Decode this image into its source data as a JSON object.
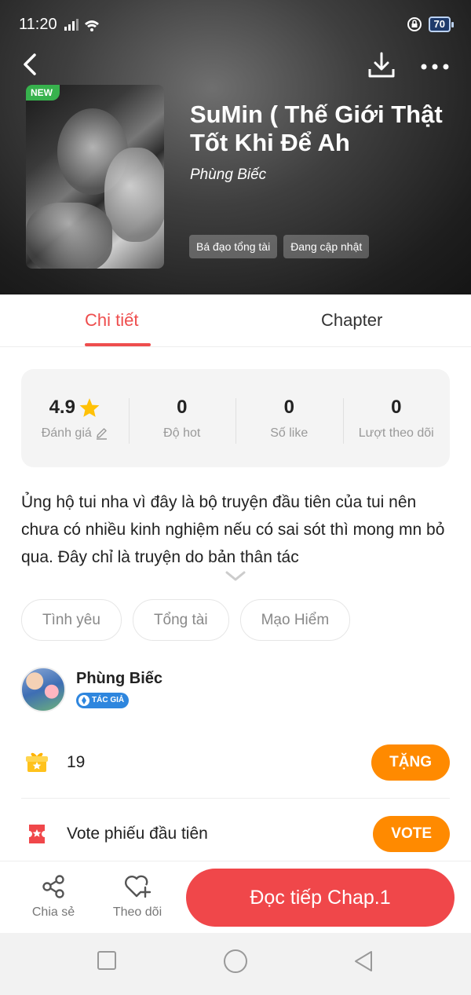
{
  "status_bar": {
    "time": "11:20",
    "battery": "70"
  },
  "book": {
    "new_badge": "NEW",
    "title": "SuMin ( Thế Giới Thật Tốt Khi Để Ah",
    "author": "Phùng Biếc",
    "tags": [
      "Bá đạo tổng tài",
      "Đang cập nhật"
    ]
  },
  "tabs": {
    "detail": "Chi tiết",
    "chapter": "Chapter"
  },
  "stats": [
    {
      "value": "4.9",
      "label": "Đánh giá"
    },
    {
      "value": "0",
      "label": "Độ hot"
    },
    {
      "value": "0",
      "label": "Số like"
    },
    {
      "value": "0",
      "label": "Lượt theo dõi"
    }
  ],
  "description": "Ủng hộ tui nha vì đây là bộ truyện đầu tiên của tui nên chưa có nhiều kinh nghiệm nếu có sai sót thì mong mn bỏ qua. Đây chỉ là truyện do bản thân tác",
  "genres": [
    "Tình yêu",
    "Tổng tài",
    "Mạo Hiểm"
  ],
  "author_section": {
    "name": "Phùng Biếc",
    "badge": "TÁC GIẢ"
  },
  "gift": {
    "count": "19",
    "button": "TẶNG"
  },
  "vote": {
    "text": "Vote phiếu đầu tiên",
    "button": "VOTE"
  },
  "bottom_bar": {
    "share": "Chia sẻ",
    "follow": "Theo dõi",
    "read": "Đọc tiếp Chap.1"
  },
  "colors": {
    "accent": "#ee4d4d",
    "orange": "#ff8a00",
    "read_button": "#f0474a",
    "new_badge": "#37b24d"
  }
}
